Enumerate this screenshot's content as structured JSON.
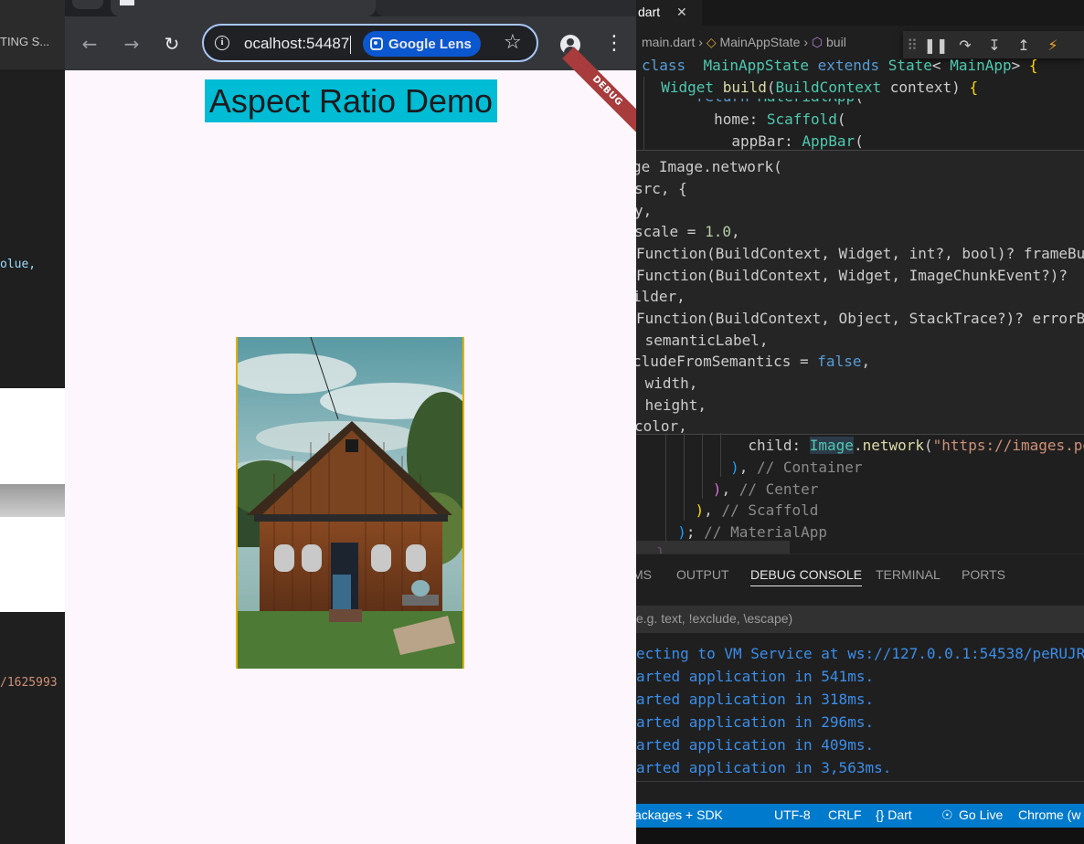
{
  "left_window": {
    "tab_text": "TING S...",
    "code_fragment_1": "olue,",
    "code_fragment_2": "/1625993"
  },
  "browser": {
    "url": "ocalhost:54487",
    "lens_label": "Google Lens",
    "debug_banner": "DEBUG",
    "app": {
      "title": "Aspect Ratio Demo"
    }
  },
  "vscode": {
    "tab": {
      "label": "dart",
      "close": "✕"
    },
    "breadcrumb": {
      "file": "main.dart",
      "cls": "MainAppState",
      "method": "buil"
    },
    "code_top": [
      "class  MainAppState extends State< MainApp> {",
      "  Widget build(BuildContext context) {",
      "      return MaterialApp(",
      "        home: Scaffold(",
      "          appBar: AppBar("
    ],
    "hover_lines": [
      "ge Image.network(",
      "src, {",
      "y,",
      "scale = 1.0,",
      "Function(BuildContext, Widget, int?, bool)? frameBu",
      "Function(BuildContext, Widget, ImageChunkEvent?)?",
      "ilder,",
      "Function(BuildContext, Object, StackTrace?)? errorB",
      " semanticLabel,",
      "cludeFromSemantics = false,",
      " width,",
      " height,",
      "color,"
    ],
    "code_bottom": [
      "            child: Image.network(\"https://images.pe",
      "          ), // Container",
      "        ), // Center",
      "      ), // Scaffold",
      "    ); // MaterialApp",
      "  }"
    ],
    "panel_tabs": [
      "MS",
      "OUTPUT",
      "DEBUG CONSOLE",
      "TERMINAL",
      "PORTS"
    ],
    "filter_placeholder": "e.g. text, !exclude, \\escape)",
    "console_lines": [
      "ecting to VM Service at ws://127.0.0.1:54538/peRUJR",
      "arted application in 541ms.",
      "arted application in 318ms.",
      "arted application in 296ms.",
      "arted application in 409ms.",
      "arted application in 3,563ms."
    ],
    "status": {
      "packages": "ackages + SDK",
      "encoding": "UTF-8",
      "eol": "CRLF",
      "language": "{} Dart",
      "golive": "Go Live",
      "device": "Chrome (w"
    }
  }
}
